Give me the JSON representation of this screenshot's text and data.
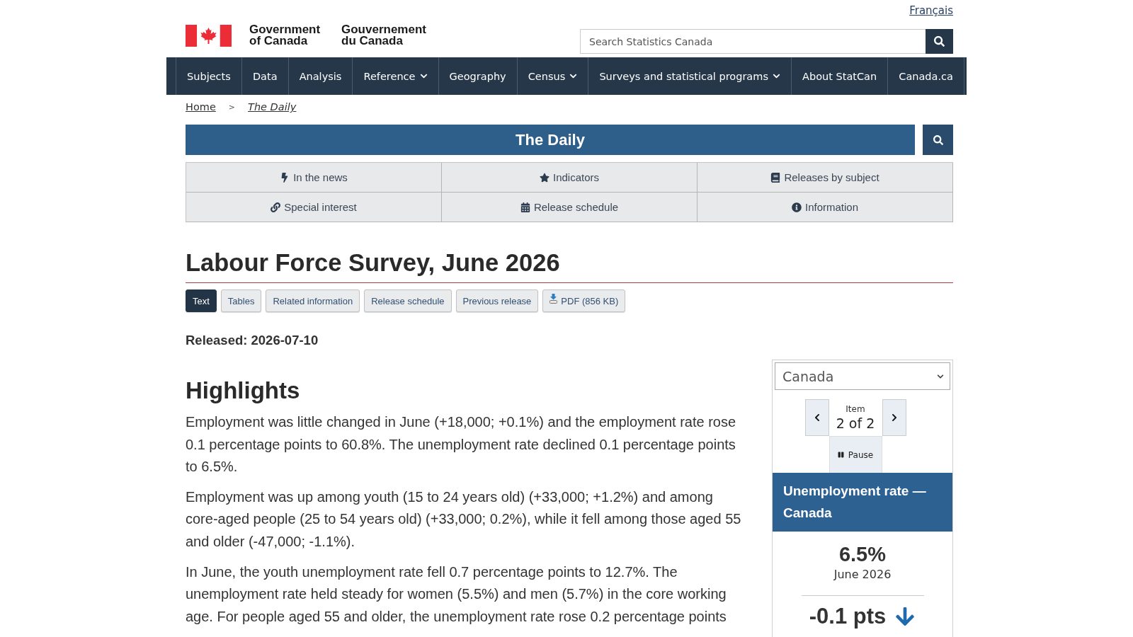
{
  "language_link": "Français",
  "signature": {
    "english": "Government of Canada",
    "french": "Gouvernement du Canada"
  },
  "search": {
    "placeholder": "Search Statistics Canada"
  },
  "main_nav": [
    {
      "label": "Subjects",
      "dropdown": false
    },
    {
      "label": "Data",
      "dropdown": false
    },
    {
      "label": "Analysis",
      "dropdown": false
    },
    {
      "label": "Reference",
      "dropdown": true
    },
    {
      "label": "Geography",
      "dropdown": false
    },
    {
      "label": "Census",
      "dropdown": true
    },
    {
      "label": "Surveys and statistical programs",
      "dropdown": true
    },
    {
      "label": "About StatCan",
      "dropdown": false
    },
    {
      "label": "Canada.ca",
      "dropdown": false
    }
  ],
  "breadcrumb": {
    "separator": ">",
    "items": [
      {
        "label": "Home",
        "current": false
      },
      {
        "label": "The Daily",
        "current": true
      }
    ]
  },
  "daily_banner": {
    "title": "The Daily"
  },
  "daily_menu": [
    {
      "label": "In the news"
    },
    {
      "label": "Indicators"
    },
    {
      "label": "Releases by subject"
    },
    {
      "label": "Special interest"
    },
    {
      "label": "Release schedule"
    },
    {
      "label": "Information"
    }
  ],
  "page_title": "Labour Force Survey, June 2026",
  "document_tabs": [
    {
      "label": "Text",
      "selected": true,
      "kind": "link"
    },
    {
      "label": "Tables",
      "selected": false,
      "kind": "link"
    },
    {
      "label": "Related information",
      "selected": false,
      "kind": "link"
    },
    {
      "label": "Release schedule",
      "selected": false,
      "kind": "link"
    },
    {
      "label": "Previous release",
      "selected": false,
      "kind": "link"
    },
    {
      "label": "PDF (856 KB)",
      "selected": false,
      "kind": "download"
    }
  ],
  "released": "Released: 2026-07-10",
  "highlights": {
    "heading": "Highlights",
    "paragraphs": [
      "Employment was little changed in June (+18,000; +0.1%) and the employment rate rose 0.1 percentage points to 60.8%. The unemployment rate declined 0.1 percentage points to 6.5%.",
      "Employment was up among youth (15 to 24 years old) (+33,000; +1.2%) and among core-aged people (25 to 54 years old) (+33,000; 0.2%), while it fell among those aged 55 and older (-47,000; -1.1%).",
      "In June, the youth unemployment rate fell 0.7 percentage points to 12.7%. The unemployment rate held steady for women (5.5%) and men (5.7%) in the core working age. For people aged 55 and older, the unemployment rate rose 0.2 percentage points"
    ]
  },
  "indicator_widget": {
    "region_select": {
      "value": "Canada"
    },
    "carousel": {
      "label": "Item",
      "position": "2 of 2",
      "pause_label": "Pause"
    },
    "card": {
      "title": "Unemployment rate — Canada",
      "value": "6.5%",
      "period": "June 2026",
      "change": "-0.1 pts",
      "falling": true
    }
  }
}
